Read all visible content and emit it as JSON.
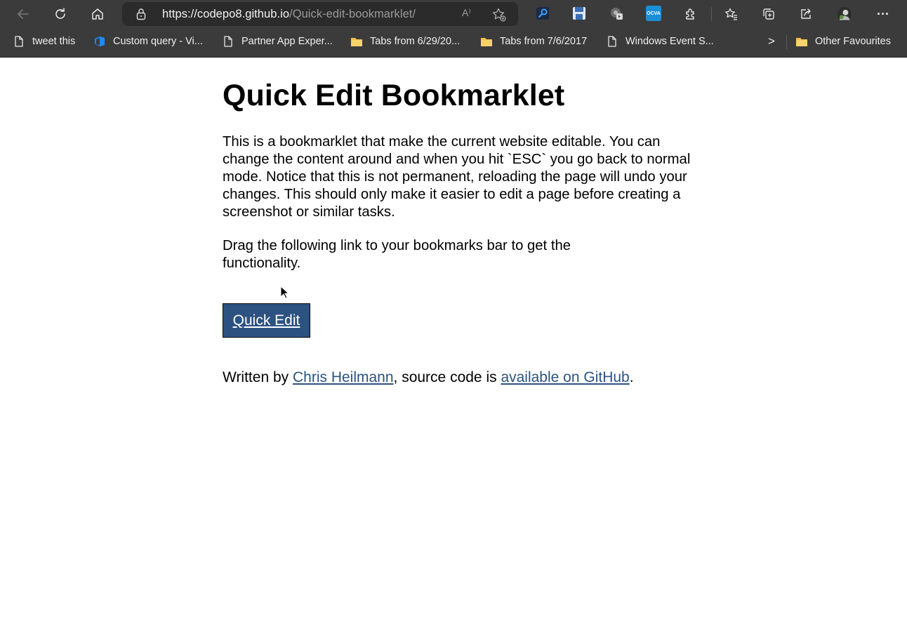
{
  "browser": {
    "url_host": "https://codepo8.github.io",
    "url_path": "/Quick-edit-bookmarklet/",
    "read_aloud_glyph": "A⁾",
    "more_glyph": "···",
    "extensions": [
      {
        "name": "key-extension",
        "color": "#1e6fd9"
      },
      {
        "name": "save-extension",
        "color": "#3a6fb3"
      },
      {
        "name": "media-extension",
        "color": "#8a8a8a"
      },
      {
        "name": "ocva-extension",
        "color": "#1b8fd6",
        "label": "OCVA"
      }
    ]
  },
  "favorites": [
    {
      "label": "tweet this",
      "icon": "page-icon"
    },
    {
      "label": "Custom query - Vi...",
      "icon": "azure-devops-icon"
    },
    {
      "label": "Partner App Exper...",
      "icon": "page-icon"
    },
    {
      "label": "Tabs from 6/29/20...",
      "icon": "folder-icon"
    },
    {
      "label": "Tabs from 7/6/2017",
      "icon": "folder-icon"
    },
    {
      "label": "Windows Event S...",
      "icon": "page-icon"
    }
  ],
  "favorites_overflow": ">",
  "other_favourites": "Other Favourites",
  "page": {
    "title": "Quick Edit Bookmarklet",
    "intro": "This is a bookmarklet that make the current website editable. You can change the content around and when you hit `ESC` you go back to normal mode. Notice that this is not permanent, reloading the page will undo your changes. This should only make it easier to edit a page before creating a screenshot or similar tasks.",
    "drag_instruction": "Drag the following link to your bookmarks bar to get the functionality.",
    "bookmarklet_label": "Quick Edit",
    "footer_prefix": "Written by ",
    "author_link": "Chris Heilmann",
    "footer_middle": ", source code is ",
    "github_link": "available on GitHub",
    "footer_suffix": "."
  },
  "colors": {
    "chrome_bg": "#3b3b3b",
    "link": "#2c5282",
    "button_bg": "#2c5282"
  }
}
